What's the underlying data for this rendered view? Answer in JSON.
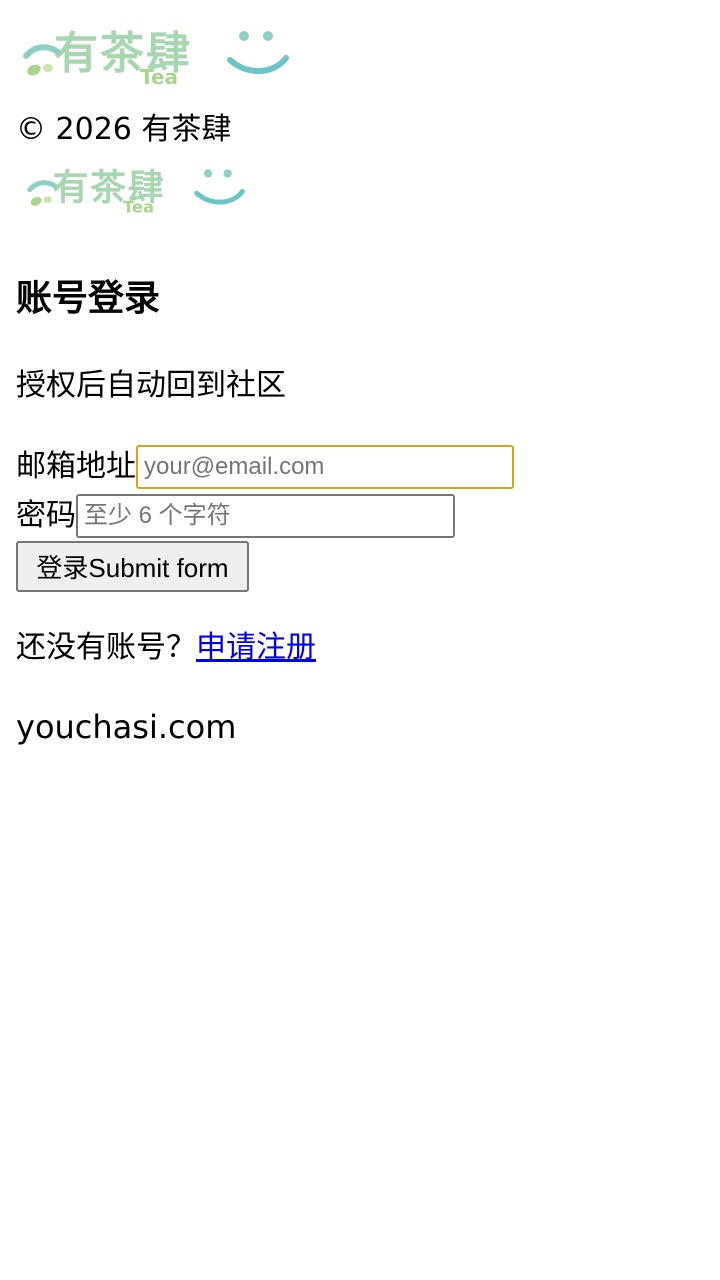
{
  "brand": {
    "logo_text": "有茶肆",
    "logo_sub": "Tea",
    "colors": {
      "teal": "#6cc5c5",
      "green": "#a7d58a",
      "light_green": "#c9e4a8"
    }
  },
  "header": {
    "copyright": "© 2026 有茶肆"
  },
  "login": {
    "title": "账号登录",
    "subtitle": "授权后自动回到社区",
    "email_label": "邮箱地址",
    "email_placeholder": "your@email.com",
    "email_value": "",
    "password_label": "密码",
    "password_placeholder": "至少 6 个字符",
    "password_value": "",
    "submit_label": "登录Submit form"
  },
  "register": {
    "prompt": "还没有账号？",
    "link_label": "申请注册"
  },
  "footer": {
    "domain": "youchasi.com"
  }
}
